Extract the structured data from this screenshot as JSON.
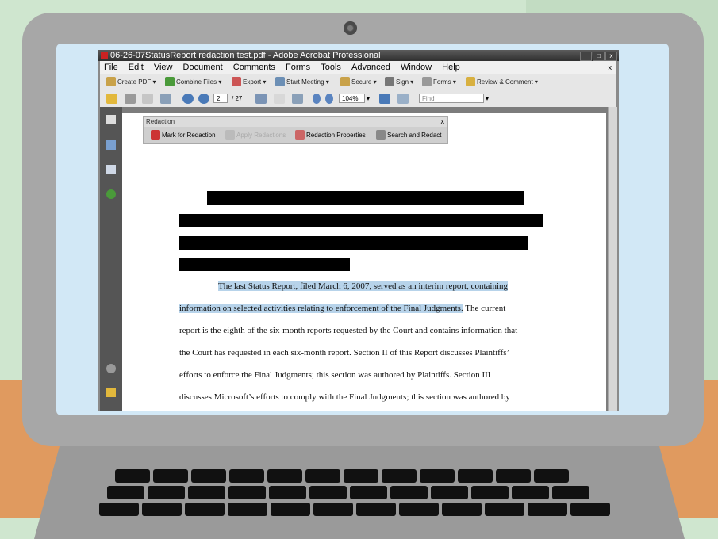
{
  "window": {
    "title": "06-26-07StatusReport redaction test.pdf - Adobe Acrobat Professional",
    "controls": [
      "_",
      "□",
      "x"
    ]
  },
  "menu": {
    "items": [
      "File",
      "Edit",
      "View",
      "Document",
      "Comments",
      "Forms",
      "Tools",
      "Advanced",
      "Window",
      "Help"
    ],
    "close": "x"
  },
  "toolbar1": {
    "create_pdf": "Create PDF ▾",
    "combine_files": "Combine Files ▾",
    "export": "Export ▾",
    "start_meeting": "Start Meeting ▾",
    "secure": "Secure ▾",
    "sign": "Sign ▾",
    "forms": "Forms ▾",
    "review_comment": "Review & Comment ▾"
  },
  "toolbar2": {
    "page_number": "2",
    "page_total": "/ 27",
    "zoom": "104%",
    "find_placeholder": "Find"
  },
  "redaction_panel": {
    "title": "Redaction",
    "close": "x",
    "mark": "Mark for Redaction",
    "apply": "Apply Redactions",
    "properties": "Redaction Properties",
    "search": "Search and Redact"
  },
  "document": {
    "line1": "The last Status Report, filed March 6, 2007, served as an interim report, containing",
    "line2a": "information on selected activities relating to enforcement of the Final Judgments.",
    "line2b": " The current",
    "line3": "report is the eighth of the six-month reports requested by the Court and contains information that",
    "line4": "the Court has requested in each six-month report.  Section II of this Report discusses Plaintiffs’",
    "line5": "efforts to enforce the Final Judgments; this section was authored by Plaintiffs.  Section III",
    "line6": "discusses Microsoft’s efforts to comply with the Final Judgments; this section was authored by"
  },
  "colors": {
    "highlight": "#b7d3ea",
    "laptop": "#a7a7a7",
    "wall": "#cfe6cf",
    "desk": "#e09a5f"
  }
}
